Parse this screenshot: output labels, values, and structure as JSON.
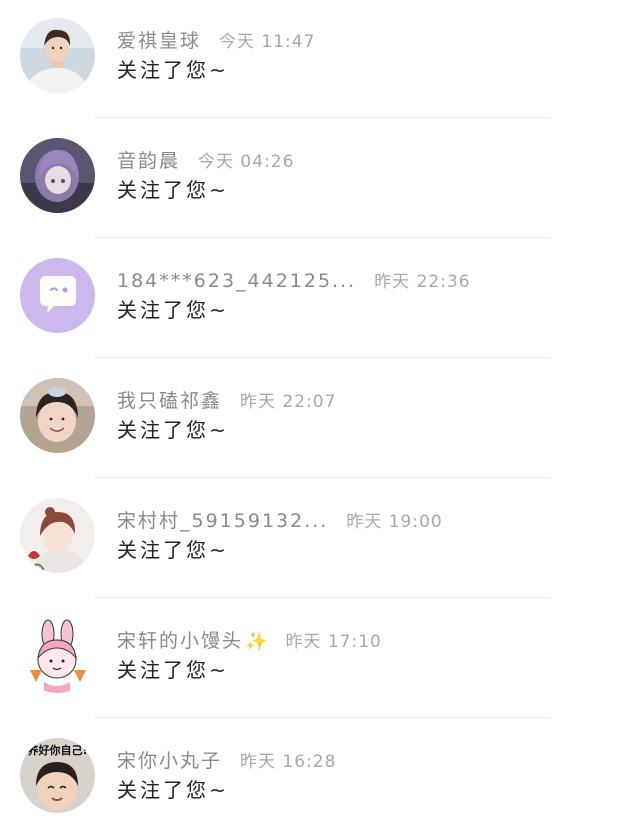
{
  "notifications": [
    {
      "name": "爱祺皇球",
      "time": "今天 11:47",
      "message": "关注了您~",
      "avatar_icon": "avatar-boy-white-sweater-icon",
      "bg": "#cfd7df"
    },
    {
      "name": "音韵晨",
      "time": "今天 04:26",
      "message": "关注了您~",
      "avatar_icon": "avatar-anime-girl-icon",
      "bg": "#5a5570"
    },
    {
      "name": "184***623_442125...",
      "time": "昨天 22:36",
      "message": "关注了您~",
      "avatar_icon": "default-chat-bubble-avatar-icon",
      "bg": "#cdb8ee"
    },
    {
      "name": "我只磕祁鑫",
      "time": "昨天 22:07",
      "message": "关注了您~",
      "avatar_icon": "avatar-smiling-girl-icon",
      "bg": "#b5a392"
    },
    {
      "name": "宋村村_59159132...",
      "time": "昨天 19:00",
      "message": "关注了您~",
      "avatar_icon": "avatar-illustrated-boy-icon",
      "bg": "#f1eeeb"
    },
    {
      "name": "宋轩的小馒头",
      "name_sparkle": "✨",
      "time": "昨天 17:10",
      "message": "关注了您~",
      "avatar_icon": "avatar-bunny-ears-cartoon-icon",
      "bg": "#fbe8ec"
    },
    {
      "name": "宋你小丸子",
      "time": "昨天 16:28",
      "message": "关注了您~",
      "avatar_icon": "avatar-boy-photo-caption-icon",
      "avatar_caption": "养好你自己!",
      "bg": "#d8d2cc"
    }
  ]
}
